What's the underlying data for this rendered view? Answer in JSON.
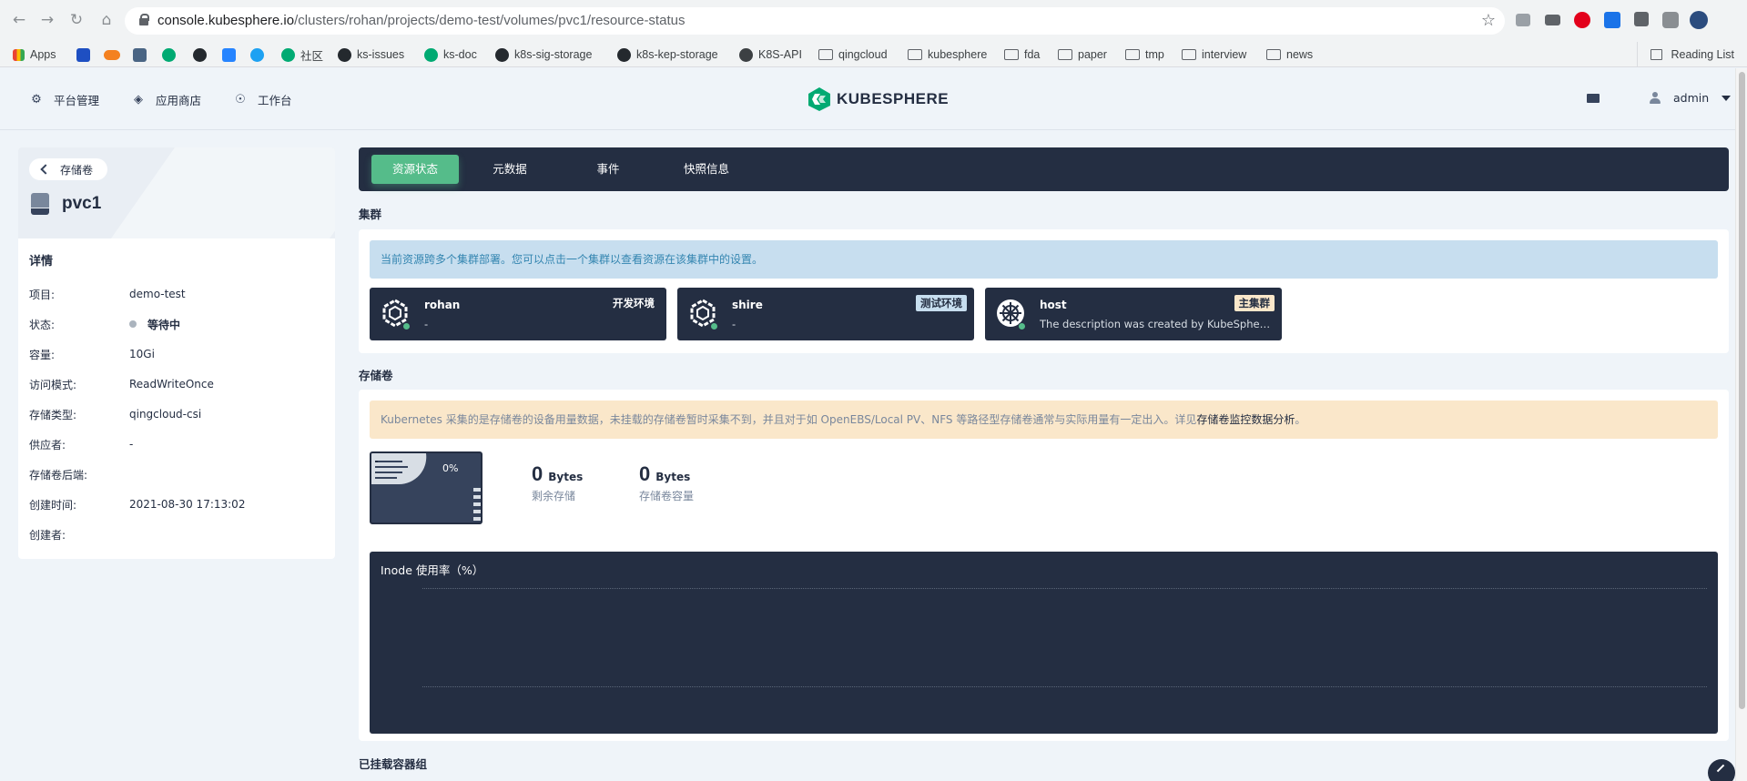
{
  "browser": {
    "url_host": "console.kubesphere.io",
    "url_path": "/clusters/rohan/projects/demo-test/volumes/pvc1/resource-status",
    "bookmarks": [
      "Apps",
      "社区",
      "ks-issues",
      "ks-doc",
      "k8s-sig-storage",
      "k8s-kep-storage",
      "K8S-API",
      "qingcloud",
      "kubesphere",
      "fda",
      "paper",
      "tmp",
      "interview",
      "news"
    ],
    "reading_list": "Reading List"
  },
  "header": {
    "nav": [
      "平台管理",
      "应用商店",
      "工作台"
    ],
    "logo": "KUBESPHERE",
    "user": "admin"
  },
  "left": {
    "back_label": "存储卷",
    "title": "pvc1",
    "detail_title": "详情",
    "details": [
      {
        "k": "项目:",
        "v": "demo-test"
      },
      {
        "k": "状态:",
        "v": "等待中"
      },
      {
        "k": "容量:",
        "v": "10Gi"
      },
      {
        "k": "访问模式:",
        "v": "ReadWriteOnce"
      },
      {
        "k": "存储类型:",
        "v": "qingcloud-csi"
      },
      {
        "k": "供应者:",
        "v": "-"
      },
      {
        "k": "存储卷后端:",
        "v": ""
      },
      {
        "k": "创建时间:",
        "v": "2021-08-30 17:13:02"
      },
      {
        "k": "创建者:",
        "v": ""
      }
    ]
  },
  "tabs": [
    "资源状态",
    "元数据",
    "事件",
    "快照信息"
  ],
  "clusters_section": {
    "label": "集群",
    "banner": "当前资源跨多个集群部署。您可以点击一个集群以查看资源在该集群中的设置。",
    "items": [
      {
        "name": "rohan",
        "desc": "-",
        "tag": "开发环境",
        "tag_color": "#242e42",
        "tag_bg": "transparent",
        "tag_fg": "#ffffff"
      },
      {
        "name": "shire",
        "desc": "-",
        "tag": "测试环境",
        "tag_bg": "#c7deef",
        "tag_fg": "#242e42"
      },
      {
        "name": "host",
        "desc": "The description was created by KubeSphere automatically",
        "tag": "主集群",
        "tag_bg": "#fae7ca",
        "tag_fg": "#242e42"
      }
    ]
  },
  "volume_section": {
    "label": "存储卷",
    "warning": "Kubernetes 采集的是存储卷的设备用量数据，未挂载的存储卷暂时采集不到，并且对于如 OpenEBS/Local PV、NFS 等路径型存储卷通常与实际用量有一定出入。详见",
    "warning_link": "存储卷监控数据分析",
    "warning_end": "。",
    "usage_percent": "0%",
    "remaining_value": "0",
    "remaining_unit": "Bytes",
    "remaining_label": "剩余存储",
    "capacity_value": "0",
    "capacity_unit": "Bytes",
    "capacity_label": "存储卷容量",
    "inode_title": "Inode 使用率（%）"
  },
  "mounted_section": {
    "label": "已挂载容器组"
  },
  "colors": {
    "accent": "#55bc8a",
    "dark": "#242e42",
    "bg": "#eff4f9"
  }
}
